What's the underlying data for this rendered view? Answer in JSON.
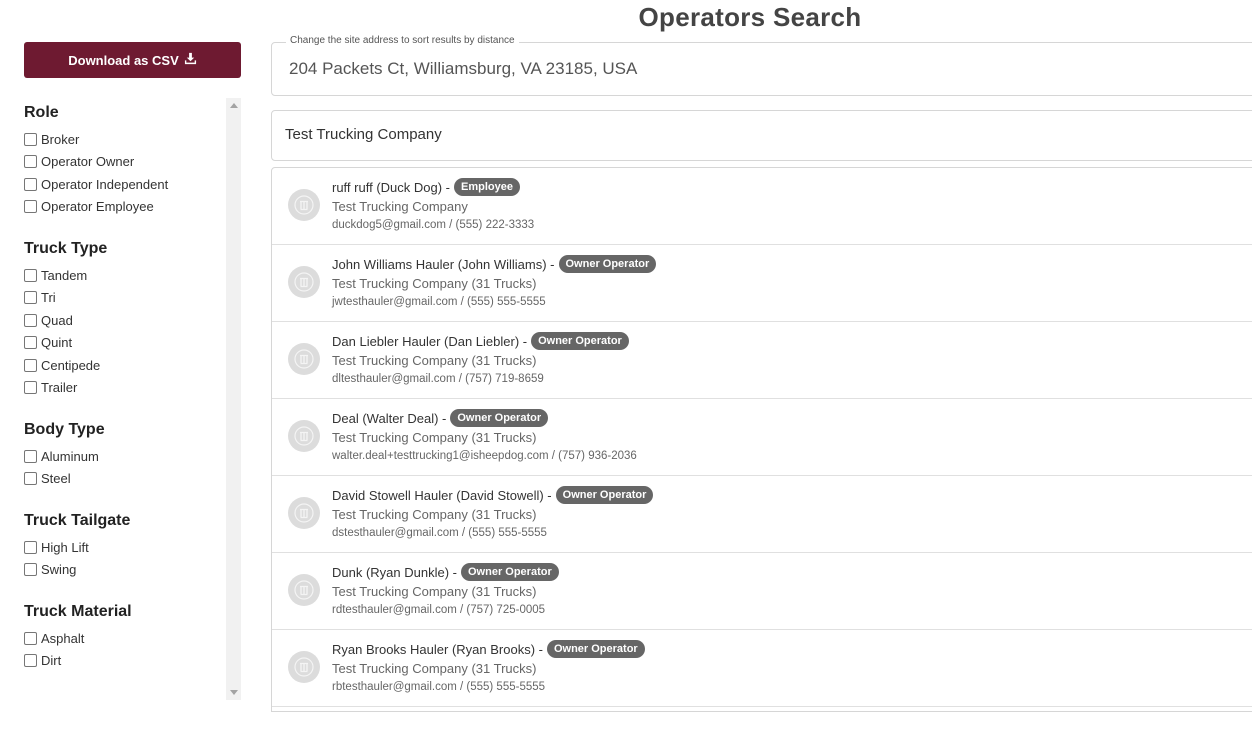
{
  "page": {
    "title": "Operators Search"
  },
  "sidebar": {
    "download_label": "Download as CSV",
    "filters": [
      {
        "heading": "Role",
        "options": [
          "Broker",
          "Operator Owner",
          "Operator Independent",
          "Operator Employee"
        ]
      },
      {
        "heading": "Truck Type",
        "options": [
          "Tandem",
          "Tri",
          "Quad",
          "Quint",
          "Centipede",
          "Trailer"
        ]
      },
      {
        "heading": "Body Type",
        "options": [
          "Aluminum",
          "Steel"
        ]
      },
      {
        "heading": "Truck Tailgate",
        "options": [
          "High Lift",
          "Swing"
        ]
      },
      {
        "heading": "Truck Material",
        "options": [
          "Asphalt",
          "Dirt"
        ]
      }
    ]
  },
  "address": {
    "label": "Change the site address to sort results by distance",
    "value": "204 Packets Ct, Williamsburg, VA 23185, USA"
  },
  "company_search": {
    "value": "Test Trucking Company"
  },
  "results": [
    {
      "name": "ruff ruff (Duck Dog) -",
      "badge": "Employee",
      "company": "Test Trucking Company",
      "contact": "duckdog5@gmail.com / (555) 222-3333"
    },
    {
      "name": "John Williams Hauler (John Williams) -",
      "badge": "Owner Operator",
      "company": "Test Trucking Company (31 Trucks)",
      "contact": "jwtesthauler@gmail.com / (555) 555-5555"
    },
    {
      "name": "Dan Liebler Hauler (Dan Liebler) -",
      "badge": "Owner Operator",
      "company": "Test Trucking Company (31 Trucks)",
      "contact": "dltesthauler@gmail.com / (757) 719-8659"
    },
    {
      "name": "Deal (Walter Deal) -",
      "badge": "Owner Operator",
      "company": "Test Trucking Company (31 Trucks)",
      "contact": "walter.deal+testtrucking1@isheepdog.com / (757) 936-2036"
    },
    {
      "name": "David Stowell Hauler (David Stowell) -",
      "badge": "Owner Operator",
      "company": "Test Trucking Company (31 Trucks)",
      "contact": "dstesthauler@gmail.com / (555) 555-5555"
    },
    {
      "name": "Dunk (Ryan Dunkle) -",
      "badge": "Owner Operator",
      "company": "Test Trucking Company (31 Trucks)",
      "contact": "rdtesthauler@gmail.com / (757) 725-0005"
    },
    {
      "name": "Ryan Brooks Hauler (Ryan Brooks) -",
      "badge": "Owner Operator",
      "company": "Test Trucking Company (31 Trucks)",
      "contact": "rbtesthauler@gmail.com / (555) 555-5555"
    }
  ],
  "colors": {
    "brand": "#6e1a31",
    "badge": "#666666"
  },
  "icons": {
    "download": "download-icon",
    "avatar": "user-placeholder-icon"
  }
}
